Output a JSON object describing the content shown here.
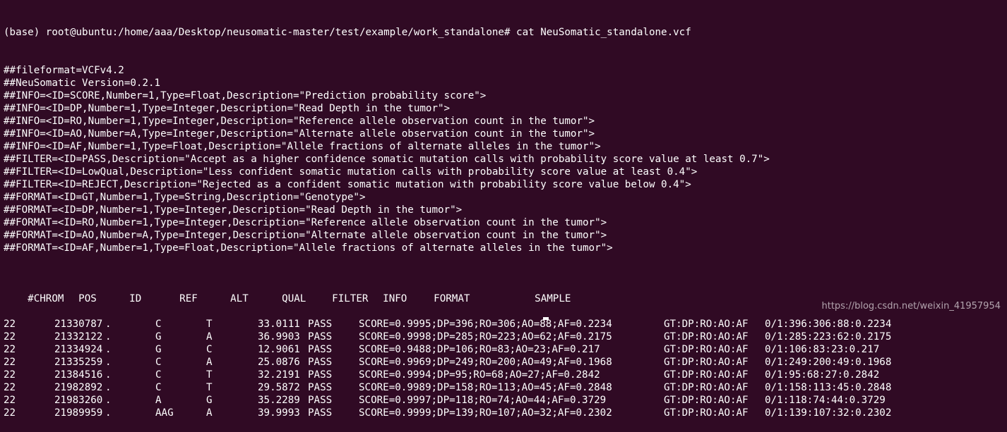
{
  "terminal": {
    "prompt": "(base) root@ubuntu:/home/aaa/Desktop/neusomatic-master/test/example/work_standalone# cat NeuSomatic_standalone.vcf",
    "header_lines": [
      "##fileformat=VCFv4.2",
      "##NeuSomatic Version=0.2.1",
      "##INFO=<ID=SCORE,Number=1,Type=Float,Description=\"Prediction probability score\">",
      "##INFO=<ID=DP,Number=1,Type=Integer,Description=\"Read Depth in the tumor\">",
      "##INFO=<ID=RO,Number=1,Type=Integer,Description=\"Reference allele observation count in the tumor\">",
      "##INFO=<ID=AO,Number=A,Type=Integer,Description=\"Alternate allele observation count in the tumor\">",
      "##INFO=<ID=AF,Number=1,Type=Float,Description=\"Allele fractions of alternate alleles in the tumor\">",
      "##FILTER=<ID=PASS,Description=\"Accept as a higher confidence somatic mutation calls with probability score value at least 0.7\">",
      "##FILTER=<ID=LowQual,Description=\"Less confident somatic mutation calls with probability score value at least 0.4\">",
      "##FILTER=<ID=REJECT,Description=\"Rejected as a confident somatic mutation with probability score value below 0.4\">",
      "##FORMAT=<ID=GT,Number=1,Type=String,Description=\"Genotype\">",
      "##FORMAT=<ID=DP,Number=1,Type=Integer,Description=\"Read Depth in the tumor\">",
      "##FORMAT=<ID=RO,Number=1,Type=Integer,Description=\"Reference allele observation count in the tumor\">",
      "##FORMAT=<ID=AO,Number=A,Type=Integer,Description=\"Alternate allele observation count in the tumor\">",
      "##FORMAT=<ID=AF,Number=1,Type=Float,Description=\"Allele fractions of alternate alleles in the tumor\">"
    ],
    "columns": [
      "#CHROM",
      "POS",
      "ID",
      "REF",
      "ALT",
      "QUAL",
      "FILTER",
      "INFO",
      "FORMAT",
      "SAMPLE"
    ],
    "rows": [
      [
        "22",
        "21330787",
        ".",
        "C",
        "T",
        "33.0111",
        "PASS",
        "SCORE=0.9995;DP=396;RO=306;AO=88;AF=0.2234",
        "GT:DP:RO:AO:AF",
        "0/1:396:306:88:0.2234"
      ],
      [
        "22",
        "21332122",
        ".",
        "G",
        "A",
        "36.9903",
        "PASS",
        "SCORE=0.9998;DP=285;RO=223;AO=62;AF=0.2175",
        "GT:DP:RO:AO:AF",
        "0/1:285:223:62:0.2175"
      ],
      [
        "22",
        "21334924",
        ".",
        "G",
        "C",
        "12.9061",
        "PASS",
        "SCORE=0.9488;DP=106;RO=83;AO=23;AF=0.217",
        "GT:DP:RO:AO:AF",
        "0/1:106:83:23:0.217"
      ],
      [
        "22",
        "21335259",
        ".",
        "C",
        "A",
        "25.0876",
        "PASS",
        "SCORE=0.9969;DP=249;RO=200;AO=49;AF=0.1968",
        "GT:DP:RO:AO:AF",
        "0/1:249:200:49:0.1968"
      ],
      [
        "22",
        "21384516",
        ".",
        "C",
        "T",
        "32.2191",
        "PASS",
        "SCORE=0.9994;DP=95;RO=68;AO=27;AF=0.2842",
        "GT:DP:RO:AO:AF",
        "0/1:95:68:27:0.2842"
      ],
      [
        "22",
        "21982892",
        ".",
        "C",
        "T",
        "29.5872",
        "PASS",
        "SCORE=0.9989;DP=158;RO=113;AO=45;AF=0.2848",
        "GT:DP:RO:AO:AF",
        "0/1:158:113:45:0.2848"
      ],
      [
        "22",
        "21983260",
        ".",
        "A",
        "G",
        "35.2289",
        "PASS",
        "SCORE=0.9997;DP=118;RO=74;AO=44;AF=0.3729",
        "GT:DP:RO:AO:AF",
        "0/1:118:74:44:0.3729"
      ],
      [
        "22",
        "21989959",
        ".",
        "AAG",
        "A",
        "39.9993",
        "PASS",
        "SCORE=0.9999;DP=139;RO=107;AO=32;AF=0.2302",
        "GT:DP:RO:AO:AF",
        "0/1:139:107:32:0.2302"
      ]
    ]
  },
  "watermark": "https://blog.csdn.net/weixin_41957954",
  "colors": {
    "background": "#300a24",
    "text": "#ffffff"
  }
}
